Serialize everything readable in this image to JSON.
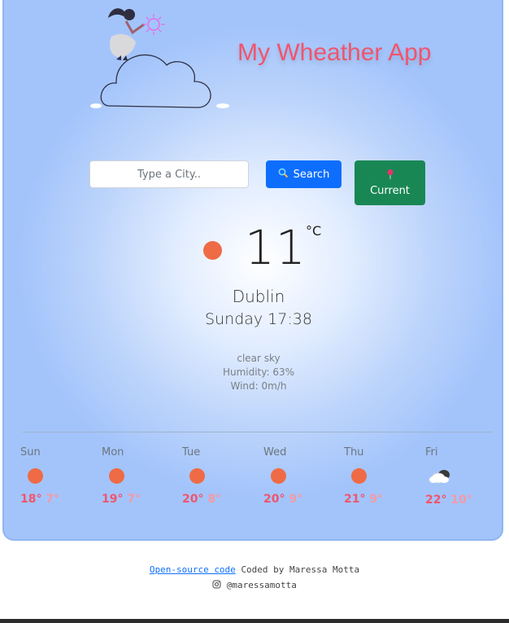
{
  "header": {
    "title": "My Wheather App"
  },
  "search": {
    "placeholder": "Type a City..",
    "search_label": "Search",
    "current_label": "Current"
  },
  "current": {
    "icon": "sun-icon",
    "temperature": "11",
    "unit": "°C",
    "city": "Dublin",
    "datetime": "Sunday 17:38",
    "description": "clear sky",
    "humidity": "Humidity: 63%",
    "wind": "Wind: 0m/h"
  },
  "forecast": [
    {
      "day": "Sun",
      "icon": "sun-icon",
      "max": "18°",
      "min": "7°"
    },
    {
      "day": "Mon",
      "icon": "sun-icon",
      "max": "19°",
      "min": "7°"
    },
    {
      "day": "Tue",
      "icon": "sun-icon",
      "max": "20°",
      "min": "8°"
    },
    {
      "day": "Wed",
      "icon": "sun-icon",
      "max": "20°",
      "min": "9°"
    },
    {
      "day": "Thu",
      "icon": "sun-icon",
      "max": "21°",
      "min": "9°"
    },
    {
      "day": "Fri",
      "icon": "cloud-icon",
      "max": "22°",
      "min": "10°"
    }
  ],
  "footer": {
    "source_link": "Open-source code",
    "credit": "Coded by Maressa Motta",
    "instagram": "@maressamotta"
  },
  "colors": {
    "accent": "#f0556c",
    "search_button": "#0d6efd",
    "current_button": "#198754",
    "sun": "#ef6b45"
  }
}
